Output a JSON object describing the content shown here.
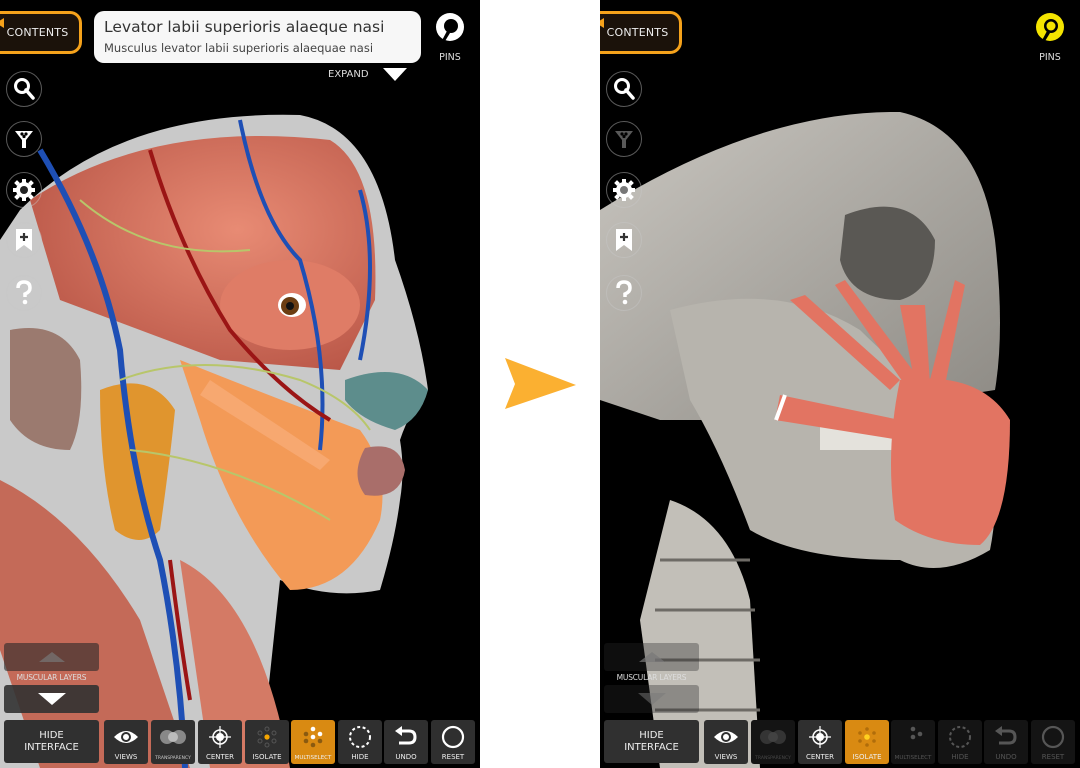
{
  "colors": {
    "accent_orange": "#f5a21b",
    "active_tool": "#d98a12",
    "pins_active": "#f4e400",
    "transition_arrow": "#fbb031",
    "background": "#000000"
  },
  "panels": [
    {
      "id": "before",
      "contents_label": "CONTENTS",
      "structure_title": "Levator labii superioris alaeque nasi",
      "structure_latin": "Musculus levator labii superioris alaequae nasi",
      "expand_label": "EXPAND",
      "pins": {
        "label": "PINS",
        "active": false,
        "icon": "pin-icon"
      },
      "side_tools": [
        {
          "name": "search",
          "icon": "search-icon",
          "enabled": true
        },
        {
          "name": "filter",
          "icon": "filter-icon",
          "enabled": true
        },
        {
          "name": "settings",
          "icon": "gear-icon",
          "enabled": true
        },
        {
          "name": "bookmark",
          "icon": "bookmark-add-icon",
          "enabled": true
        },
        {
          "name": "help",
          "icon": "help-icon",
          "enabled": true
        }
      ],
      "layers_label": "MUSCULAR LAYERS",
      "hide_interface_line1": "HIDE",
      "hide_interface_line2": "INTERFACE",
      "toolbar": [
        {
          "label": "VIEWS",
          "icon": "eye-icon",
          "state": "normal"
        },
        {
          "label": "TRANSPARENCY",
          "icon": "transparency-icon",
          "state": "normal"
        },
        {
          "label": "CENTER",
          "icon": "crosshair-icon",
          "state": "normal"
        },
        {
          "label": "ISOLATE",
          "icon": "isolate-icon",
          "state": "normal"
        },
        {
          "label": "MULTISELECT",
          "icon": "multiselect-icon",
          "state": "active"
        },
        {
          "label": "HIDE",
          "icon": "dashed-circle-icon",
          "state": "normal"
        },
        {
          "label": "UNDO",
          "icon": "undo-icon",
          "state": "normal"
        },
        {
          "label": "RESET",
          "icon": "circle-icon",
          "state": "normal"
        }
      ],
      "scene_description": "3D head with facial muscles, blood vessels, nerves and parotid gland"
    },
    {
      "id": "after",
      "contents_label": "CONTENTS",
      "pins": {
        "label": "PINS",
        "active": true,
        "icon": "pin-icon"
      },
      "side_tools": [
        {
          "name": "search",
          "icon": "search-icon",
          "enabled": true
        },
        {
          "name": "filter",
          "icon": "filter-icon",
          "enabled": false
        },
        {
          "name": "settings",
          "icon": "gear-icon",
          "enabled": true
        },
        {
          "name": "bookmark",
          "icon": "bookmark-add-icon",
          "enabled": true
        },
        {
          "name": "help",
          "icon": "help-icon",
          "enabled": true
        }
      ],
      "layers_label": "MUSCULAR LAYERS",
      "hide_interface_line1": "HIDE",
      "hide_interface_line2": "INTERFACE",
      "toolbar": [
        {
          "label": "VIEWS",
          "icon": "eye-icon",
          "state": "normal"
        },
        {
          "label": "TRANSPARENCY",
          "icon": "transparency-icon",
          "state": "disabled"
        },
        {
          "label": "CENTER",
          "icon": "crosshair-icon",
          "state": "normal"
        },
        {
          "label": "ISOLATE",
          "icon": "isolate-icon",
          "state": "active"
        },
        {
          "label": "MULTISELECT",
          "icon": "multiselect-icon",
          "state": "disabled"
        },
        {
          "label": "HIDE",
          "icon": "dashed-circle-icon",
          "state": "disabled"
        },
        {
          "label": "UNDO",
          "icon": "undo-icon",
          "state": "disabled"
        },
        {
          "label": "RESET",
          "icon": "circle-icon",
          "state": "disabled"
        }
      ],
      "scene_description": "Isolated skull and cervical spine with selected facial muscles"
    }
  ]
}
